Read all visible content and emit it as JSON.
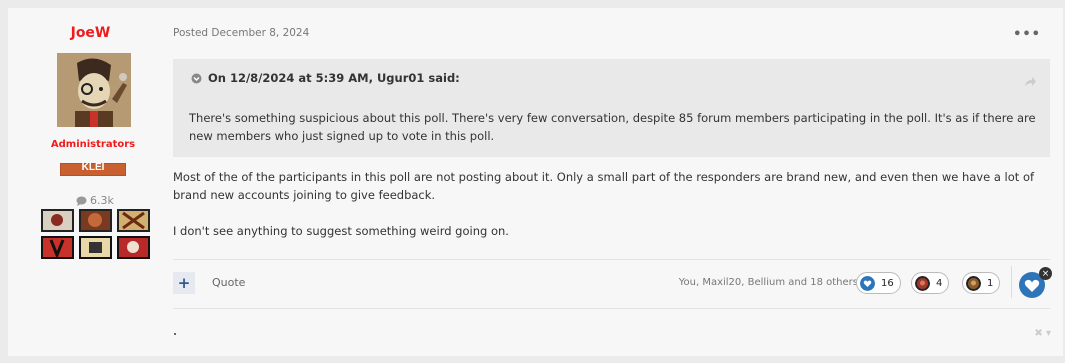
{
  "author": {
    "name": "JoeW",
    "group": "Administrators",
    "group_badge_text": "KLEI",
    "reputation": "6.3k",
    "avatar_icon": "avatar-icon",
    "badge_icons": [
      "badge-1-icon",
      "badge-2-icon",
      "badge-3-icon",
      "badge-4-icon",
      "badge-5-icon",
      "badge-6-icon"
    ]
  },
  "post": {
    "posted": "Posted December 8, 2024",
    "more_label": "•••",
    "quote": {
      "header": "On 12/8/2024 at 5:39 AM, Ugur01 said:",
      "body": "There's something suspicious about this poll. There's very few conversation, despite 85 forum members participating in the poll. It's as if there are new members who just signed up to vote in this poll."
    },
    "paragraphs": [
      "Most of the of the participants in this poll are not posting about it. Only a small part of the responders are brand new, and even then we have a lot of brand new accounts joining to give feedback.",
      "I don't see anything to suggest something weird going on."
    ]
  },
  "footer": {
    "plus_label": "+",
    "quote_label": "Quote",
    "reactors_text": "You, Maxil20, Bellium and 18 others",
    "reactions": [
      {
        "icon": "heart-reaction-icon",
        "count": "16",
        "color": "#2d75b8"
      },
      {
        "icon": "red-reaction-icon",
        "count": "4",
        "color": "#a1362c"
      },
      {
        "icon": "bronze-reaction-icon",
        "count": "1",
        "color": "#8a5a2c"
      }
    ],
    "bottom_right": "✖ ▾"
  },
  "colors": {
    "author_red": "#ee1c1c",
    "heart_blue": "#2d75b8"
  }
}
